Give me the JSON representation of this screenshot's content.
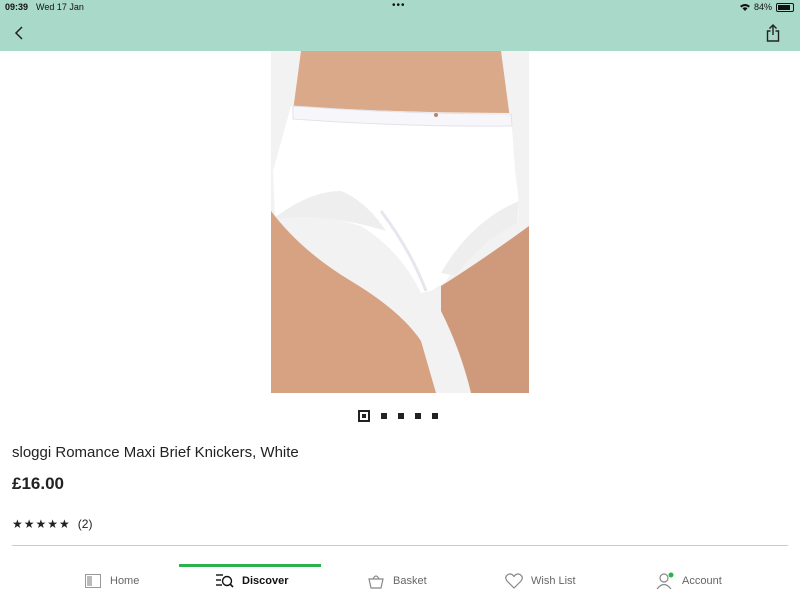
{
  "status_bar": {
    "time": "09:39",
    "date": "Wed 17 Jan",
    "battery": "84%",
    "battery_level": 0.84
  },
  "nav": {
    "back_icon": "chevron-left-icon",
    "share_icon": "share-icon"
  },
  "product": {
    "title": "sloggi Romance Maxi Brief Knickers, White",
    "price": "£16.00",
    "rating_stars": "★★★★★",
    "rating_value": 5,
    "rating_count": "(2)",
    "image_count": 5,
    "current_image": 1
  },
  "tabbar": {
    "home": "Home",
    "discover": "Discover",
    "basket": "Basket",
    "wishlist": "Wish List",
    "account": "Account",
    "active_tab": "Discover",
    "accent_color": "#2bb24c"
  },
  "colors": {
    "header_bg": "#a9d9c8",
    "accent": "#2bb24c"
  }
}
